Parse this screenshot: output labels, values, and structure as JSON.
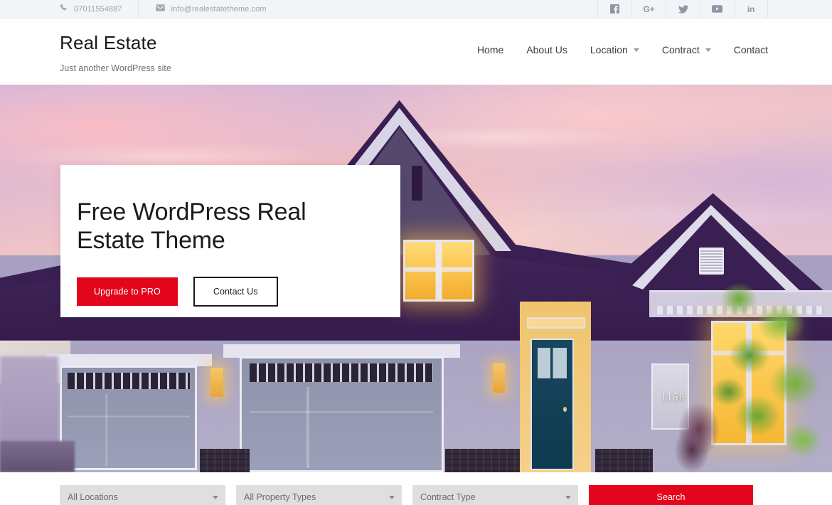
{
  "topbar": {
    "phone": "07011554887",
    "email": "info@realestatetheme.com",
    "phone_icon": "phone-icon",
    "email_icon": "envelope-icon",
    "socials": [
      {
        "name": "facebook",
        "label": "f"
      },
      {
        "name": "google-plus",
        "label": "G+"
      },
      {
        "name": "twitter",
        "label": ""
      },
      {
        "name": "youtube",
        "label": ""
      },
      {
        "name": "linkedin",
        "label": "in"
      }
    ]
  },
  "header": {
    "site_title": "Real Estate",
    "tagline": "Just another WordPress site",
    "nav": [
      {
        "label": "Home",
        "has_dropdown": false
      },
      {
        "label": "About Us",
        "has_dropdown": false
      },
      {
        "label": "Location",
        "has_dropdown": true
      },
      {
        "label": "Contract",
        "has_dropdown": true
      },
      {
        "label": "Contact",
        "has_dropdown": false
      }
    ]
  },
  "hero": {
    "title": "Free WordPress Real Estate Theme",
    "primary_button": "Upgrade to PRO",
    "secondary_button": "Contact Us",
    "house_number": "1156"
  },
  "search": {
    "location": "All Locations",
    "property_type": "All Property Types",
    "contract_type": "Contract Type",
    "button": "Search"
  },
  "colors": {
    "accent_red": "#e3051b",
    "topbar_bg": "#f2f4f7",
    "select_bg": "#dfdfdf",
    "text_dark": "#1b1b1b"
  }
}
